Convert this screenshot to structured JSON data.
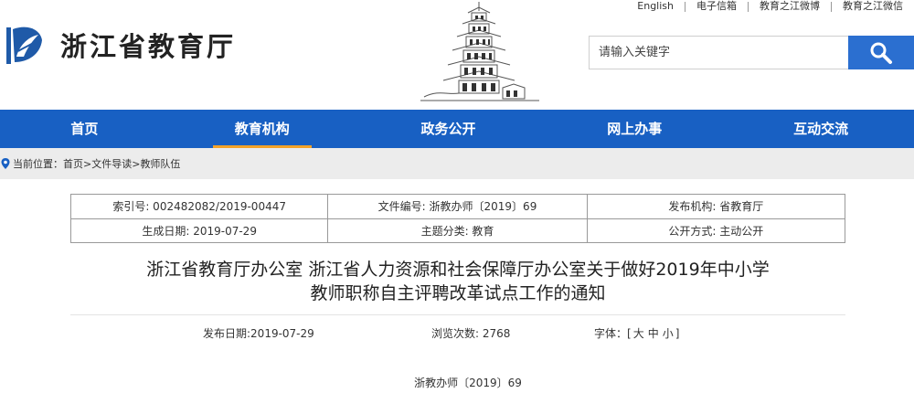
{
  "top_links": [
    "English",
    "电子信箱",
    "教育之江微博",
    "教育之江微信"
  ],
  "site": {
    "name": "浙江省教育厅"
  },
  "search": {
    "placeholder": "请输入关键字"
  },
  "nav": {
    "items": [
      "首页",
      "教育机构",
      "政务公开",
      "网上办事",
      "互动交流"
    ],
    "active_index": 1
  },
  "breadcrumb": {
    "label": "当前位置：",
    "items": [
      "首页",
      "文件导读",
      "教师队伍"
    ],
    "separator": ">"
  },
  "meta_table": {
    "rows": [
      [
        "索引号: 002482082/2019-00447",
        "文件编号: 浙教办师〔2019〕69",
        "发布机构: 省教育厅"
      ],
      [
        "生成日期: 2019-07-29",
        "主题分类: 教育",
        "公开方式: 主动公开"
      ]
    ]
  },
  "article": {
    "title_line1": "浙江省教育厅办公室 浙江省人力资源和社会保障厅办公室关于做好2019年中小学",
    "title_line2": "教师职称自主评聘改革试点工作的通知",
    "publish_date": "发布日期:2019-07-29",
    "views": "浏览次数: 2768",
    "font_label": "字体：[",
    "font_sizes": [
      "大",
      "中",
      "小"
    ],
    "font_close": "]",
    "doc_number": "浙教办师〔2019〕69"
  },
  "colors": {
    "nav_bg": "#1860c3",
    "nav_active_underline": "#f3a228",
    "search_button": "#2b6fd0",
    "breadcrumb_bg": "#ececec"
  },
  "icons": {
    "logo": "zhejiang-education-leaf-logo",
    "search": "magnifier-icon",
    "location": "location-pin-icon",
    "banner": "pagoda-illustration"
  }
}
